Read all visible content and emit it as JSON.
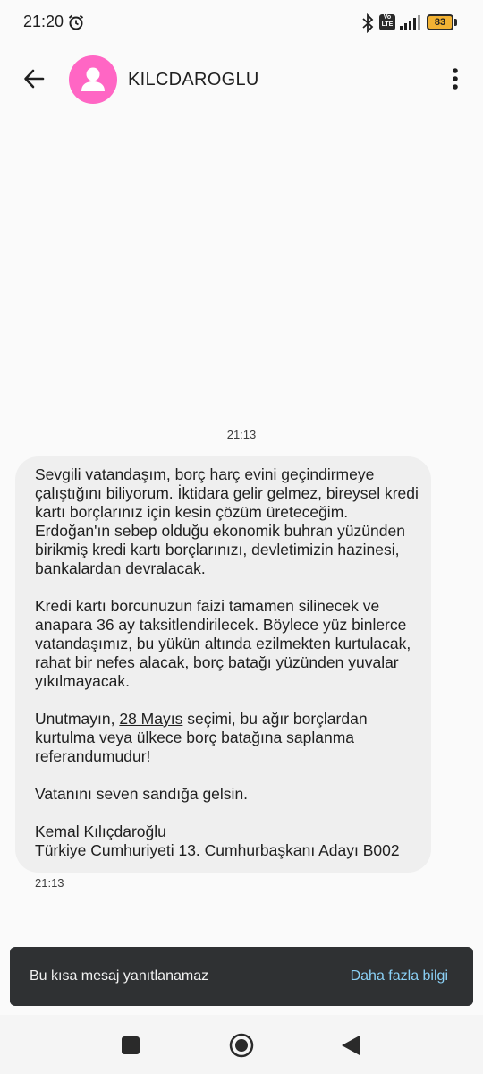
{
  "status_bar": {
    "time": "21:20",
    "battery": "83",
    "volte": "Vo LTE",
    "icons": [
      "alarm-icon",
      "bluetooth-icon",
      "volte-icon",
      "signal-icon",
      "battery-icon"
    ]
  },
  "app_bar": {
    "contact_name": "KILCDAROGLU",
    "icons": [
      "back-arrow-icon",
      "person-icon",
      "more-vert-icon"
    ],
    "avatar_color": "#ff66c4"
  },
  "conversation": {
    "timestamp_top": "21:13",
    "message": {
      "paragraphs": [
        "Sevgili vatandaşım, borç harç evini geçindirmeye çalıştığını biliyorum. İktidara gelir gelmez, bireysel kredi kartı borçlarınız için kesin çözüm üreteceğim. Erdoğan'ın sebep olduğu ekonomik buhran yüzünden birikmiş kredi kartı borçlarınızı, devletimizin hazinesi, bankalardan devralacak.",
        "Kredi kartı borcunuzun faizi tamamen silinecek ve anapara 36 ay taksitlendirilecek. Böylece yüz binlerce vatandaşımız, bu yükün altında ezilmekten kurtulacak, rahat bir nefes alacak, borç batağı yüzünden yuvalar yıkılmayacak."
      ],
      "p3_before": "Unutmayın, ",
      "p3_link": "28 Mayıs",
      "p3_after": " seçimi, bu ağır borçlardan kurtulma veya ülkece borç batağına saplanma referandumudur!",
      "p4": "Vatanını seven sandığa gelsin.",
      "signature_name": "Kemal Kılıçdaroğlu",
      "signature_title": "Türkiye Cumhuriyeti 13. Cumhurbaşkanı Adayı B002"
    },
    "timestamp_bottom": "21:13"
  },
  "snackbar": {
    "text": "Bu kısa mesaj yanıtlanamaz",
    "action": "Daha fazla bilgi",
    "action_color": "#8ad0f5"
  },
  "nav_bar": {
    "icons": [
      "recents-square-icon",
      "home-circle-icon",
      "back-triangle-icon"
    ]
  }
}
